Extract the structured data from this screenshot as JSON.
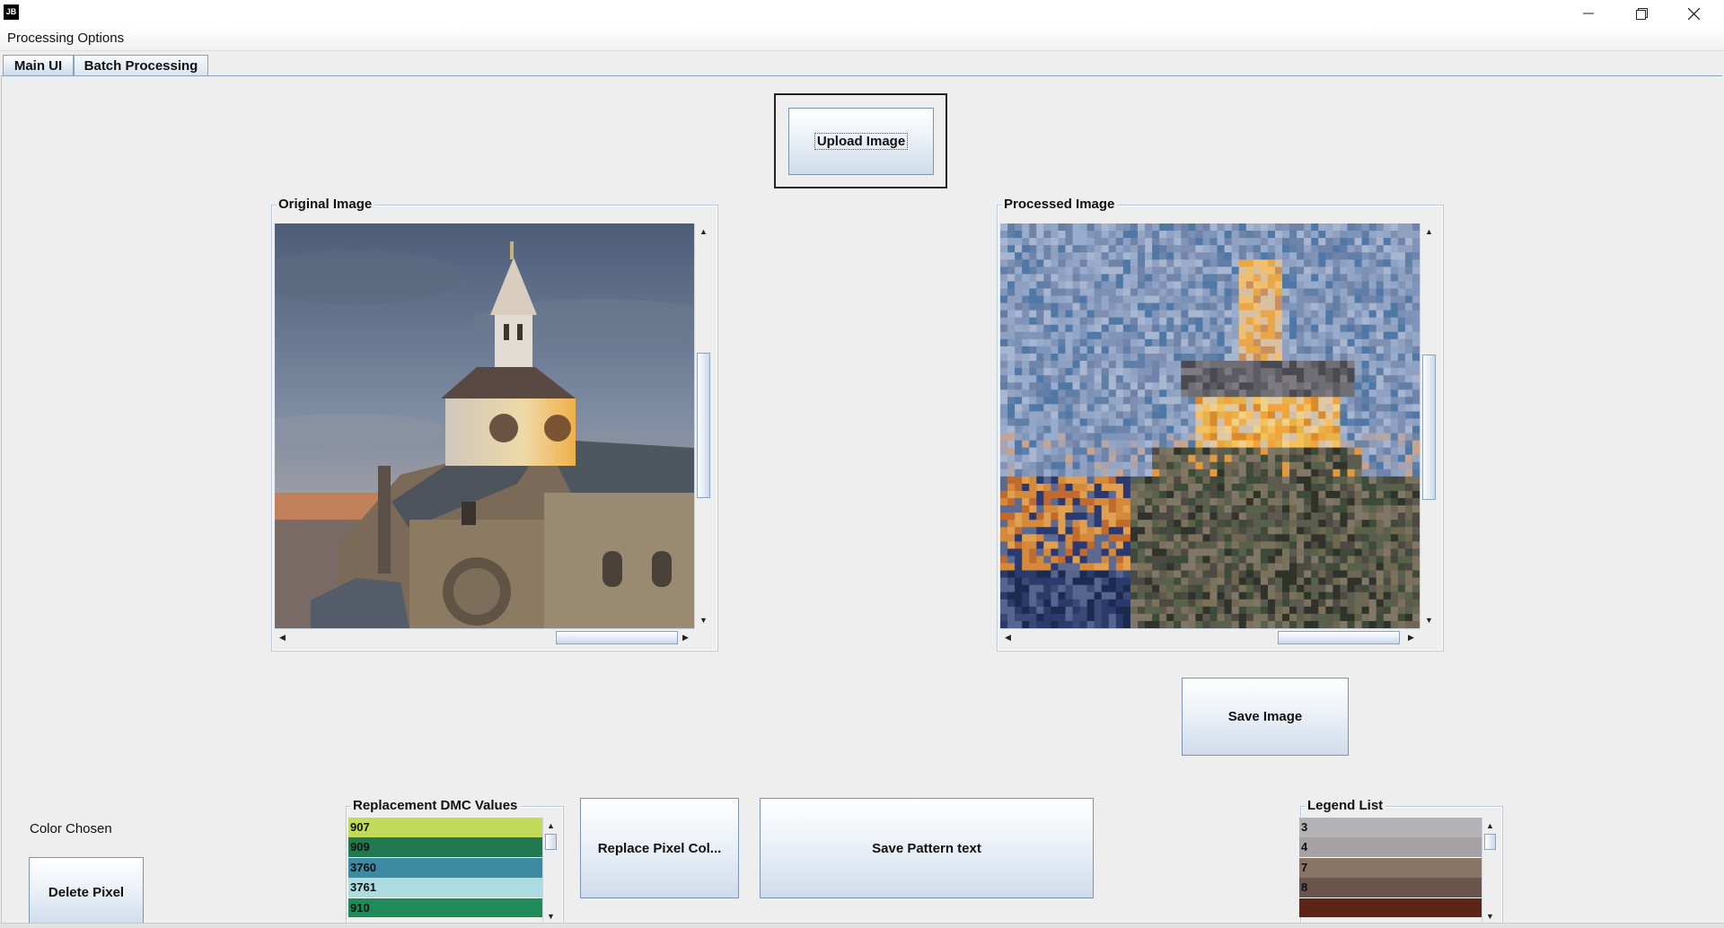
{
  "window": {
    "app_icon": "JB",
    "icons": {
      "minimize": "minimize-icon",
      "maximize": "restore-icon",
      "close": "close-icon"
    }
  },
  "menu": {
    "processing_options": "Processing Options"
  },
  "tabs": [
    {
      "label": "Main UI",
      "active": true
    },
    {
      "label": "Batch Processing",
      "active": false
    }
  ],
  "main": {
    "upload_button": "Upload Image",
    "original_panel_title": "Original Image",
    "processed_panel_title": "Processed Image",
    "save_image_button": "Save Image",
    "color_chosen_label": "Color Chosen",
    "delete_pixel_button": "Delete Pixel",
    "replacement_title": "Replacement DMC Values",
    "replace_button": "Replace Pixel Col...",
    "save_pattern_button": "Save Pattern text",
    "legend_title": "Legend List"
  },
  "replacement_values": [
    {
      "label": "907",
      "color": "#c3d959"
    },
    {
      "label": "909",
      "color": "#217a4f"
    },
    {
      "label": "3760",
      "color": "#3d8aa3"
    },
    {
      "label": "3761",
      "color": "#acdbe0"
    },
    {
      "label": "910",
      "color": "#1f8a5a"
    }
  ],
  "legend_values": [
    {
      "label": "3",
      "color": "#b3b2b6"
    },
    {
      "label": "4",
      "color": "#a6a2a4"
    },
    {
      "label": "7",
      "color": "#8a7464"
    },
    {
      "label": "8",
      "color": "#6a544c"
    },
    {
      "label": "",
      "color": "#5b2414"
    }
  ],
  "colors": {
    "window_bg": "#eeeeee",
    "tab_border": "#8aa3bf"
  }
}
